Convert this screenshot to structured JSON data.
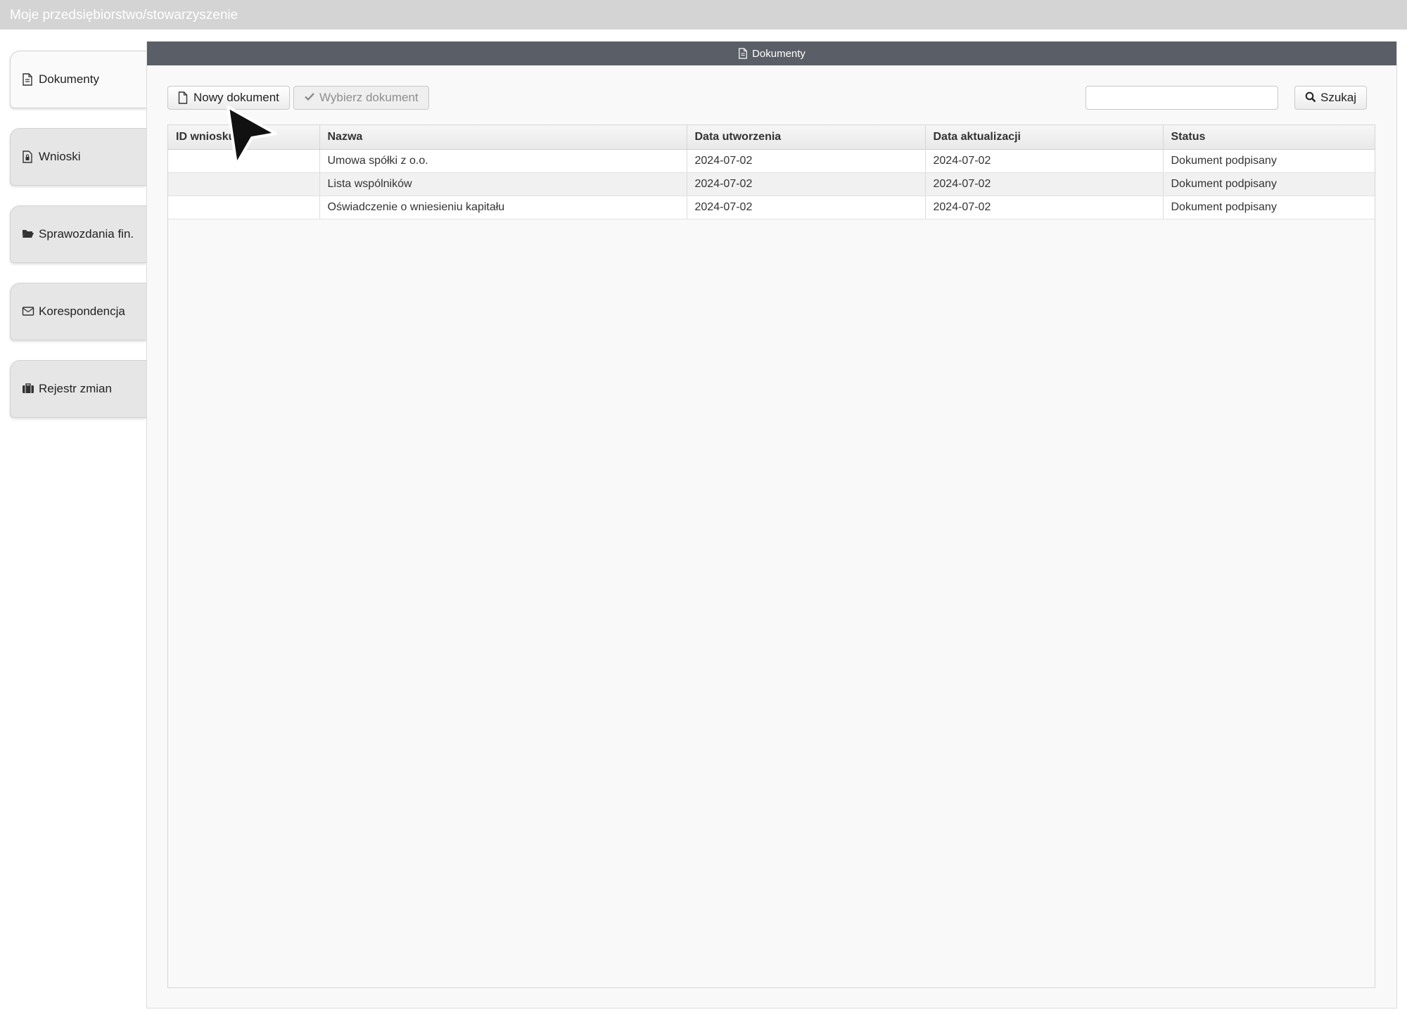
{
  "window": {
    "title": "Moje przedsiębiorstwo/stowarzyszenie"
  },
  "sidebar": {
    "items": [
      {
        "label": "Dokumenty",
        "icon": "document-icon",
        "active": true
      },
      {
        "label": "Wnioski",
        "icon": "file-lock-icon",
        "active": false
      },
      {
        "label": "Sprawozdania fin.",
        "icon": "folder-open-icon",
        "active": false
      },
      {
        "label": "Korespondencja",
        "icon": "envelope-icon",
        "active": false
      },
      {
        "label": "Rejestr zmian",
        "icon": "briefcase-icon",
        "active": false
      }
    ]
  },
  "panel": {
    "title": "Dokumenty",
    "icon": "document-icon"
  },
  "toolbar": {
    "new_document": "Nowy dokument",
    "select_document": "Wybierz dokument",
    "search_value": "",
    "search_button": "Szukaj"
  },
  "table": {
    "columns": [
      "ID wniosku",
      "Nazwa",
      "Data utworzenia",
      "Data aktualizacji",
      "Status"
    ],
    "rows": [
      [
        "",
        "Umowa spółki z o.o.",
        "2024-07-02",
        "2024-07-02",
        "Dokument podpisany"
      ],
      [
        "",
        "Lista wspólników",
        "2024-07-02",
        "2024-07-02",
        "Dokument podpisany"
      ],
      [
        "",
        "Oświadczenie o wniesieniu kapitału",
        "2024-07-02",
        "2024-07-02",
        "Dokument podpisany"
      ]
    ]
  },
  "colors": {
    "title_bar": "#d4d4d4",
    "panel_header": "#5a5e66",
    "panel_background": "#f9f9f9"
  }
}
